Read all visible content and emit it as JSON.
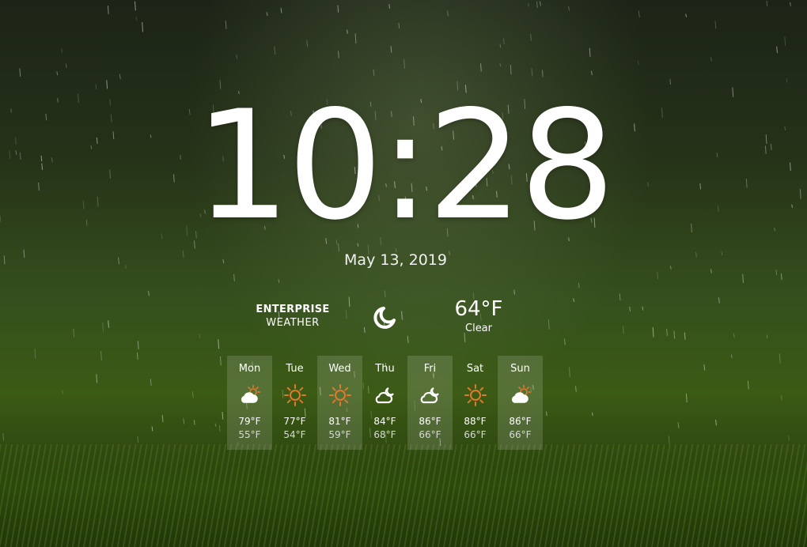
{
  "clock": {
    "time": "10:28",
    "date": "May 13, 2019"
  },
  "brand": {
    "line1": "ENTERPRISE",
    "line2": "WEATHER"
  },
  "current": {
    "icon": "moon-icon",
    "temp": "64°F",
    "condition": "Clear"
  },
  "forecast": [
    {
      "day": "Mon",
      "icon": "partly-cloudy-icon",
      "high": "79°F",
      "low": "55°F",
      "highlighted": true
    },
    {
      "day": "Tue",
      "icon": "sun-icon",
      "high": "77°F",
      "low": "54°F",
      "highlighted": false
    },
    {
      "day": "Wed",
      "icon": "sun-icon",
      "high": "81°F",
      "low": "59°F",
      "highlighted": true
    },
    {
      "day": "Thu",
      "icon": "partly-cloudy-night-icon",
      "high": "84°F",
      "low": "68°F",
      "highlighted": false
    },
    {
      "day": "Fri",
      "icon": "partly-cloudy-night-icon",
      "high": "86°F",
      "low": "66°F",
      "highlighted": true
    },
    {
      "day": "Sat",
      "icon": "sun-icon",
      "high": "88°F",
      "low": "66°F",
      "highlighted": false
    },
    {
      "day": "Sun",
      "icon": "partly-cloudy-icon",
      "high": "86°F",
      "low": "66°F",
      "highlighted": true
    }
  ],
  "colors": {
    "sun": "#e07a2e",
    "text": "#ffffff"
  }
}
